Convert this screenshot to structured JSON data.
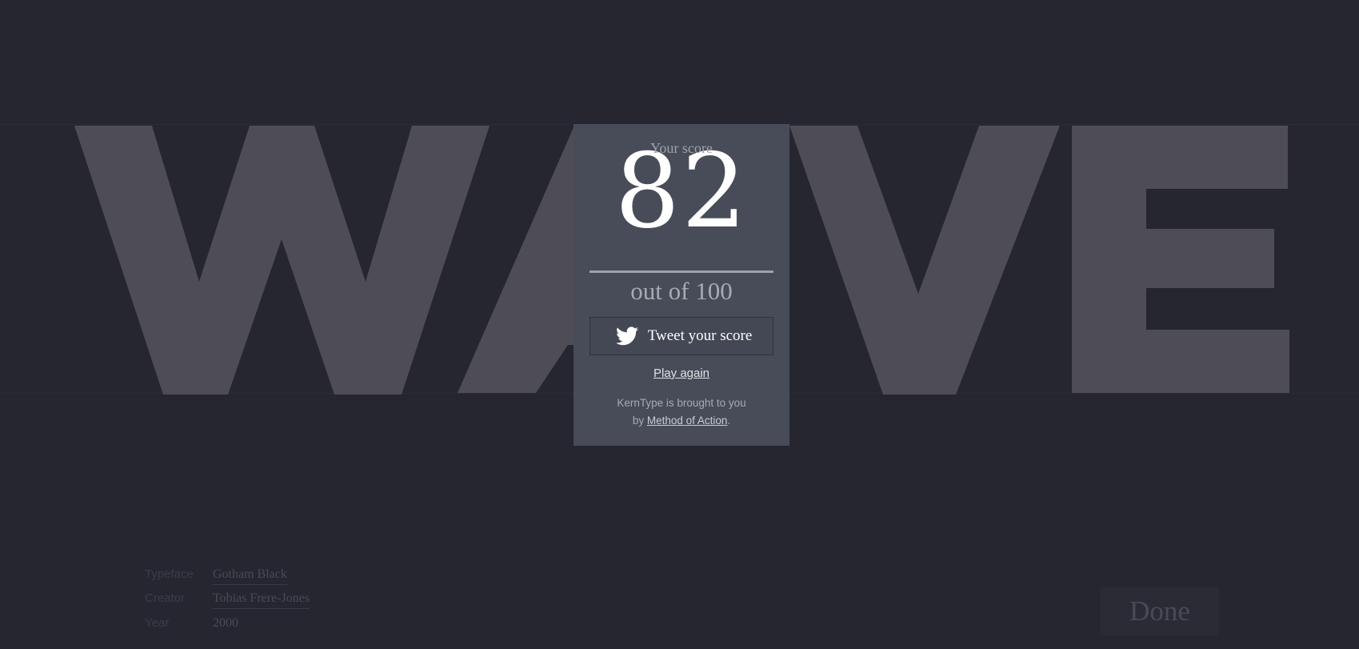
{
  "game": {
    "word": "WAVE"
  },
  "result": {
    "score_label": "Your score",
    "score": "82",
    "out_of": "out of 100",
    "tweet_label": "Tweet your score",
    "play_again": "Play again",
    "credit_prefix": "KernType is brought to you",
    "credit_by": "by",
    "credit_link": "Method of Action",
    "credit_suffix": "."
  },
  "font_info": {
    "typeface_label": "Typeface",
    "typeface_value": "Gotham Black",
    "creator_label": "Creator",
    "creator_value": "Tobias Frere-Jones",
    "year_label": "Year",
    "year_value": "2000"
  },
  "actions": {
    "done_label": "Done"
  },
  "colors": {
    "background": "#262631",
    "letters": "#4e4d55",
    "modal": "#474c58",
    "score_text": "#ffffff"
  },
  "icons": {
    "tweet": "twitter-bird-icon"
  }
}
